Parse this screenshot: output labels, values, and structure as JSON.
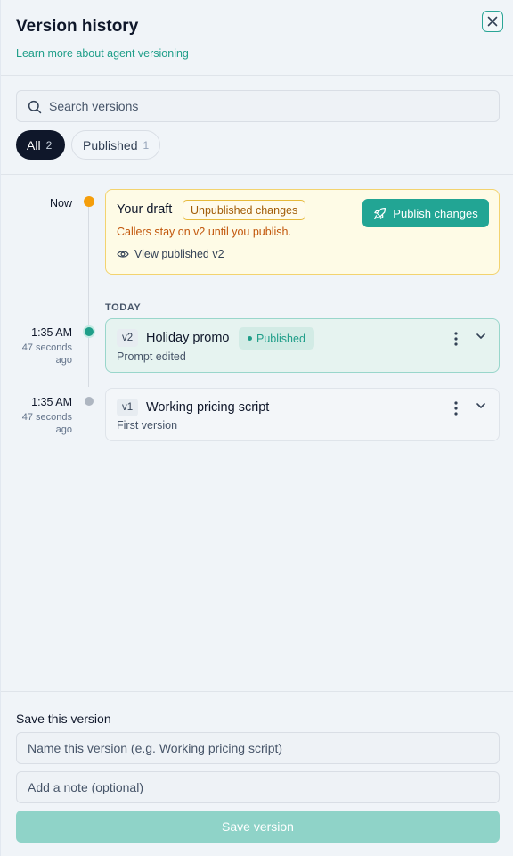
{
  "header": {
    "title": "Version history",
    "learn_link": "Learn more about agent versioning"
  },
  "search": {
    "placeholder": "Search versions",
    "value": ""
  },
  "filters": [
    {
      "label": "All",
      "count": "2",
      "selected": true
    },
    {
      "label": "Published",
      "count": "1",
      "selected": false
    }
  ],
  "draft": {
    "time": "Now",
    "title": "Your draft",
    "badge": "Unpublished changes",
    "message": "Callers stay on v2 until you publish.",
    "view_link": "View published v2",
    "publish_label": "Publish changes"
  },
  "section_label": "TODAY",
  "versions": [
    {
      "time": "1:35 AM",
      "ago_line1": "47 seconds",
      "ago_line2": "ago",
      "tag": "v2",
      "name": "Holiday promo",
      "status": "Published",
      "note": "Prompt edited"
    },
    {
      "time": "1:35 AM",
      "ago_line1": "47 seconds",
      "ago_line2": "ago",
      "tag": "v1",
      "name": "Working pricing script",
      "status": "",
      "note": "First version"
    }
  ],
  "save": {
    "title": "Save this version",
    "name_placeholder": "Name this version (e.g. Working pricing script)",
    "note_placeholder": "Add a note (optional)",
    "button_label": "Save version"
  },
  "colors": {
    "accent": "#22a594",
    "draft_dot": "#f59e0b",
    "published_dot": "#1f9e89",
    "old_dot": "#aeb6c1"
  },
  "icons": [
    "close-icon",
    "search-icon",
    "rocket-icon",
    "eye-icon",
    "kebab-menu-icon",
    "chevron-down-icon"
  ]
}
